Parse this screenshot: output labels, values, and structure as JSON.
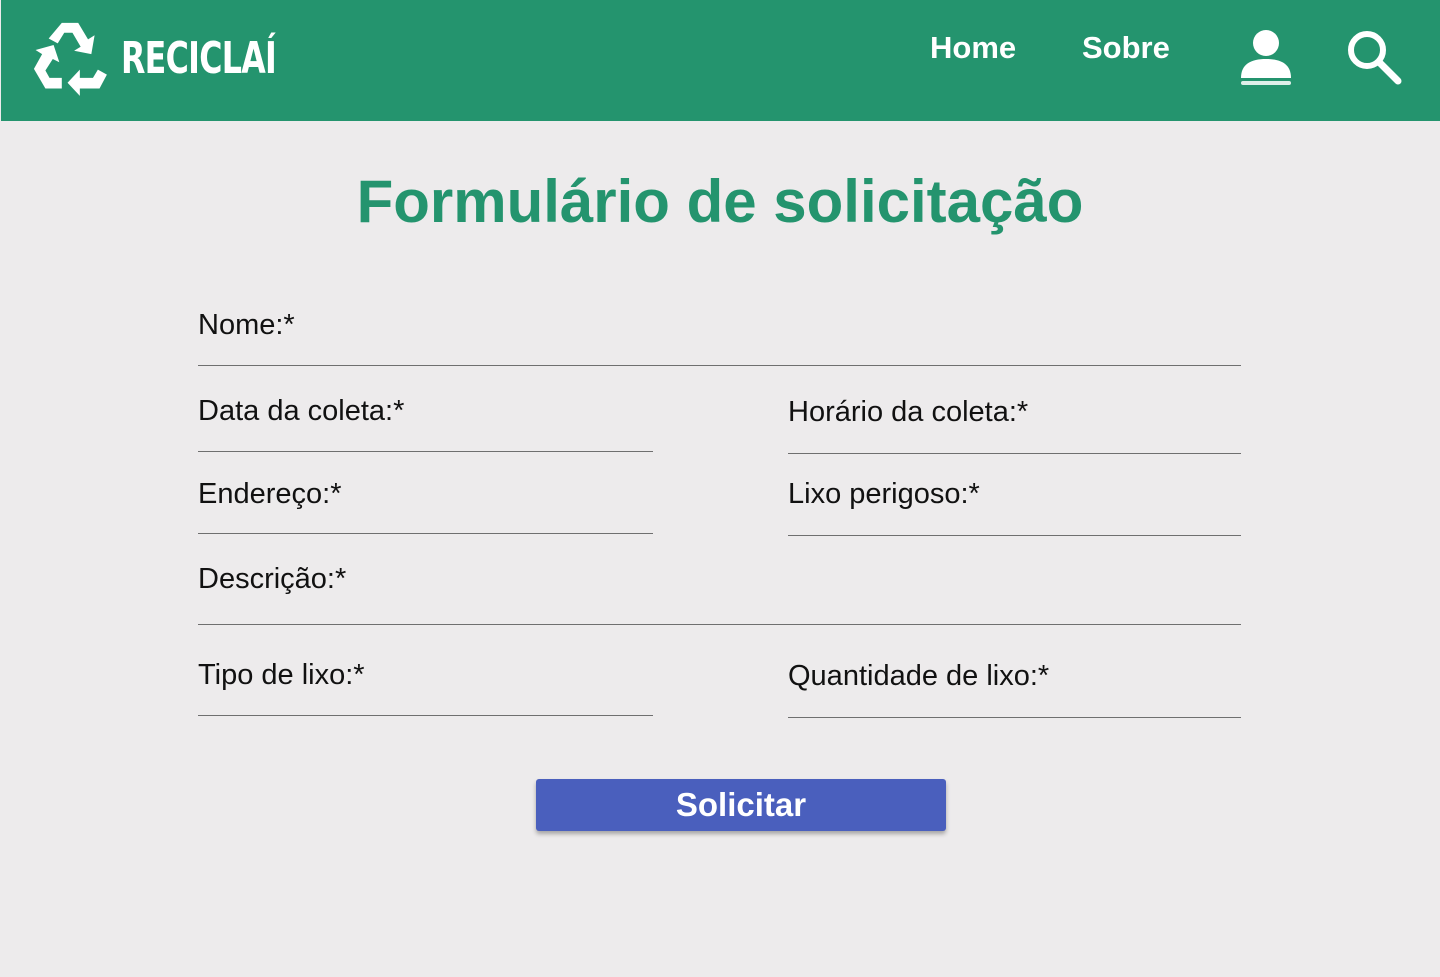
{
  "header": {
    "brand": "RECICLAÍ",
    "logo_icon": "recycle-icon",
    "nav": [
      {
        "label": "Home"
      },
      {
        "label": "Sobre"
      }
    ],
    "user_icon": "user-icon",
    "search_icon": "search-icon",
    "background_color": "#24946e"
  },
  "page": {
    "title": "Formulário de solicitação",
    "background_color": "#edebec"
  },
  "form": {
    "fields": [
      {
        "label": "Nome:*",
        "value": ""
      },
      {
        "label": "Data da coleta:*",
        "value": ""
      },
      {
        "label": "Horário da coleta:*",
        "value": ""
      },
      {
        "label": "Endereço:*",
        "value": ""
      },
      {
        "label": "Lixo perigoso:*",
        "value": ""
      },
      {
        "label": "Descrição:*",
        "value": ""
      },
      {
        "label": "Tipo de lixo:*",
        "value": ""
      },
      {
        "label": "Quantidade de lixo:*",
        "value": ""
      }
    ],
    "submit_label": "Solicitar",
    "submit_color": "#4a5fbd"
  }
}
